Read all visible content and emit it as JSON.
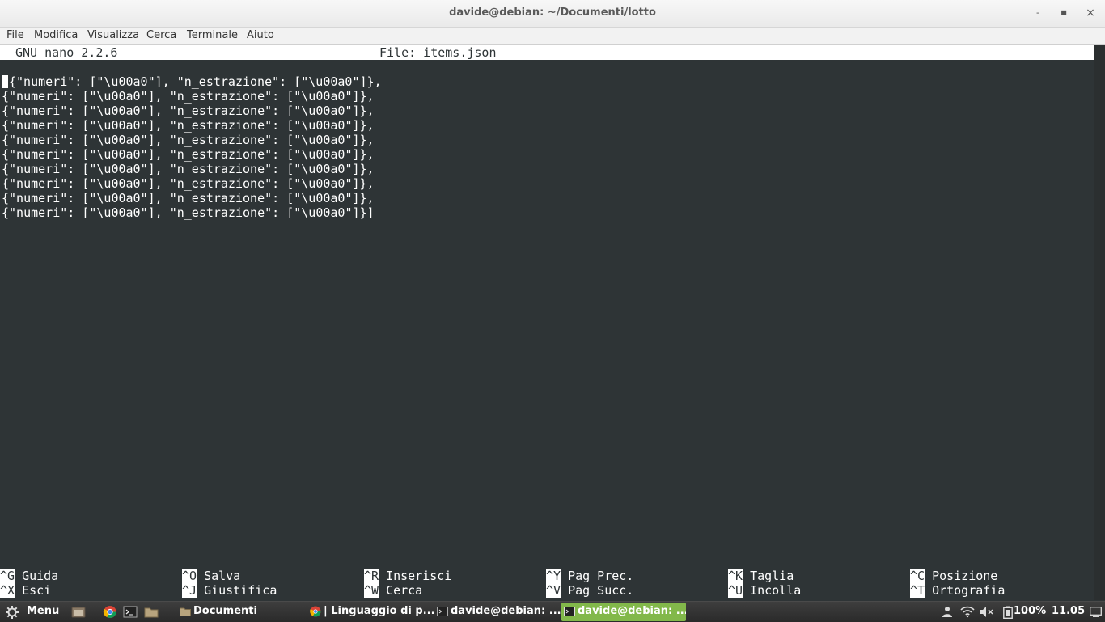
{
  "window": {
    "title": "davide@debian: ~/Documenti/lotto",
    "minimize_glyph": "-",
    "maximize_glyph": "■",
    "close_glyph": "×"
  },
  "menubar": {
    "items": [
      "File",
      "Modifica",
      "Visualizza",
      "Cerca",
      "Terminale",
      "Aiuto"
    ]
  },
  "nano": {
    "version": "GNU nano 2.2.6",
    "file": "File: items.json",
    "lines": [
      "{\"numeri\": [\"\\u00a0\"], \"n_estrazione\": [\"\\u00a0\"]},",
      "{\"numeri\": [\"\\u00a0\"], \"n_estrazione\": [\"\\u00a0\"]},",
      "{\"numeri\": [\"\\u00a0\"], \"n_estrazione\": [\"\\u00a0\"]},",
      "{\"numeri\": [\"\\u00a0\"], \"n_estrazione\": [\"\\u00a0\"]},",
      "{\"numeri\": [\"\\u00a0\"], \"n_estrazione\": [\"\\u00a0\"]},",
      "{\"numeri\": [\"\\u00a0\"], \"n_estrazione\": [\"\\u00a0\"]},",
      "{\"numeri\": [\"\\u00a0\"], \"n_estrazione\": [\"\\u00a0\"]},",
      "{\"numeri\": [\"\\u00a0\"], \"n_estrazione\": [\"\\u00a0\"]},",
      "{\"numeri\": [\"\\u00a0\"], \"n_estrazione\": [\"\\u00a0\"]},",
      "{\"numeri\": [\"\\u00a0\"], \"n_estrazione\": [\"\\u00a0\"]}]"
    ],
    "cursor_char": "[",
    "shortcuts": [
      {
        "key": "^G",
        "label": "Guida"
      },
      {
        "key": "^O",
        "label": "Salva"
      },
      {
        "key": "^R",
        "label": "Inserisci"
      },
      {
        "key": "^Y",
        "label": "Pag Prec."
      },
      {
        "key": "^K",
        "label": "Taglia"
      },
      {
        "key": "^C",
        "label": "Posizione"
      },
      {
        "key": "^X",
        "label": "Esci"
      },
      {
        "key": "^J",
        "label": "Giustifica"
      },
      {
        "key": "^W",
        "label": "Cerca"
      },
      {
        "key": "^V",
        "label": "Pag Succ."
      },
      {
        "key": "^U",
        "label": "Incolla"
      },
      {
        "key": "^T",
        "label": "Ortografia"
      }
    ]
  },
  "taskbar": {
    "menu_label": "Menu",
    "quicklaunch": [
      "file-manager-icon",
      "chrome-icon",
      "terminal-icon",
      "folder-icon"
    ],
    "windows": [
      {
        "label": "Documenti",
        "icon": "folder-icon",
        "active": false
      },
      {
        "label": "| Linguaggio di p...",
        "icon": "chrome-icon",
        "active": false
      },
      {
        "label": "davide@debian: ...",
        "icon": "terminal-icon",
        "active": false
      },
      {
        "label": "davide@debian: ...",
        "icon": "terminal-icon",
        "active": true
      }
    ],
    "battery": "100%",
    "clock": "11.05",
    "active_color": "#82b84a"
  }
}
